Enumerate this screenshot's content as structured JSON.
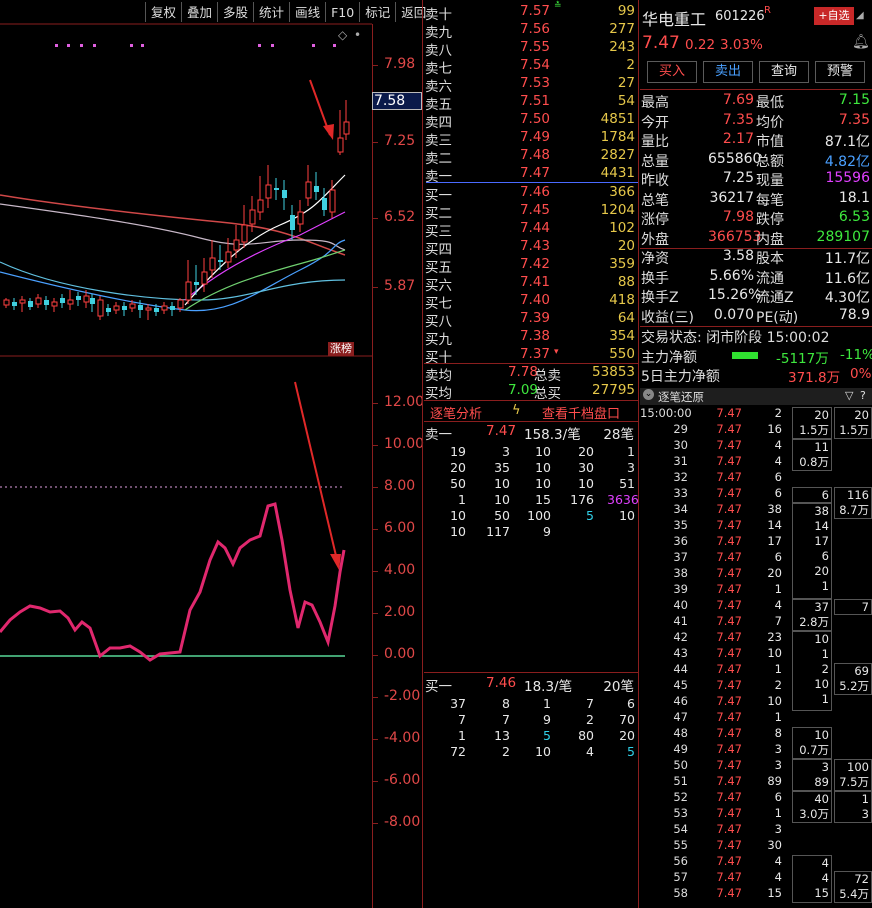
{
  "toolbar": [
    "复权",
    "叠加",
    "多股",
    "统计",
    "画线",
    "F10",
    "标记",
    "返回"
  ],
  "price_axis": [
    "7.98",
    "7.25",
    "6.52",
    "5.87"
  ],
  "current_price_tag": "7.58",
  "zhangbang": "涨榜",
  "indicator_axis": [
    "12.00",
    "10.00",
    "8.00",
    "6.00",
    "4.00",
    "2.00",
    "0.00",
    "-2.00",
    "-4.00",
    "-6.00",
    "-8.00"
  ],
  "asks": [
    {
      "label": "卖十",
      "price": "7.57",
      "vol": "99"
    },
    {
      "label": "卖九",
      "price": "7.56",
      "vol": "277"
    },
    {
      "label": "卖八",
      "price": "7.55",
      "vol": "243"
    },
    {
      "label": "卖七",
      "price": "7.54",
      "vol": "2"
    },
    {
      "label": "卖六",
      "price": "7.53",
      "vol": "27"
    },
    {
      "label": "卖五",
      "price": "7.51",
      "vol": "54"
    },
    {
      "label": "卖四",
      "price": "7.50",
      "vol": "4851"
    },
    {
      "label": "卖三",
      "price": "7.49",
      "vol": "1784"
    },
    {
      "label": "卖二",
      "price": "7.48",
      "vol": "2827"
    },
    {
      "label": "卖一",
      "price": "7.47",
      "vol": "4431"
    }
  ],
  "bids": [
    {
      "label": "买一",
      "price": "7.46",
      "vol": "366"
    },
    {
      "label": "买二",
      "price": "7.45",
      "vol": "1204"
    },
    {
      "label": "买三",
      "price": "7.44",
      "vol": "102"
    },
    {
      "label": "买四",
      "price": "7.43",
      "vol": "20"
    },
    {
      "label": "买五",
      "price": "7.42",
      "vol": "359"
    },
    {
      "label": "买六",
      "price": "7.41",
      "vol": "88"
    },
    {
      "label": "买七",
      "price": "7.40",
      "vol": "418"
    },
    {
      "label": "买八",
      "price": "7.39",
      "vol": "64"
    },
    {
      "label": "买九",
      "price": "7.38",
      "vol": "354"
    },
    {
      "label": "买十",
      "price": "7.37",
      "vol": "550"
    }
  ],
  "avg": {
    "sell_label": "卖均",
    "sell_price": "7.78",
    "sell_total_label": "总卖",
    "sell_total": "53853",
    "buy_label": "买均",
    "buy_price": "7.09",
    "buy_total_label": "总买",
    "buy_total": "27795"
  },
  "tabs": {
    "left": "逐笔分析",
    "right": "查看千档盘口"
  },
  "queue_sell": {
    "label": "卖一",
    "price": "7.47",
    "amount": "158.3/笔",
    "count": "28笔",
    "rows": [
      [
        "19",
        "3",
        "10",
        "20",
        "1"
      ],
      [
        "20",
        "35",
        "10",
        "30",
        "3"
      ],
      [
        "50",
        "10",
        "10",
        "10",
        "51"
      ],
      [
        "1",
        "10",
        "15",
        "176",
        "3636"
      ],
      [
        "10",
        "50",
        "100",
        "5",
        "10"
      ],
      [
        "10",
        "117",
        "9",
        "",
        ""
      ]
    ]
  },
  "queue_buy": {
    "label": "买一",
    "price": "7.46",
    "amount": "18.3/笔",
    "count": "20笔",
    "rows": [
      [
        "37",
        "8",
        "1",
        "7",
        "6"
      ],
      [
        "7",
        "7",
        "9",
        "2",
        "70"
      ],
      [
        "1",
        "13",
        "5",
        "80",
        "20"
      ],
      [
        "72",
        "2",
        "10",
        "4",
        "5"
      ]
    ]
  },
  "stock": {
    "name": "华电重工",
    "code": "601226",
    "flag": "R",
    "add_label": "+自选",
    "price": "7.47",
    "change": "0.22",
    "pct": "3.03%"
  },
  "actions": [
    "买入",
    "卖出",
    "查询",
    "预警"
  ],
  "stats": [
    [
      "最高",
      "7.69",
      "最低",
      "7.15"
    ],
    [
      "今开",
      "7.35",
      "均价",
      "7.35"
    ],
    [
      "量比",
      "2.17",
      "市值",
      "87.1亿"
    ],
    [
      "总量",
      "655860",
      "总额",
      "4.82亿"
    ],
    [
      "昨收",
      "7.25",
      "现量",
      "15596"
    ],
    [
      "总笔",
      "36217",
      "每笔",
      "18.1"
    ],
    [
      "涨停",
      "7.98",
      "跌停",
      "6.53"
    ],
    [
      "外盘",
      "366753",
      "内盘",
      "289107"
    ],
    [
      "净资",
      "3.58",
      "股本",
      "11.7亿"
    ],
    [
      "换手",
      "5.66%",
      "流通",
      "11.6亿"
    ],
    [
      "换手Z",
      "15.26%",
      "流通Z",
      "4.30亿"
    ],
    [
      "收益(三)",
      "0.070",
      "PE(动)",
      "78.9"
    ]
  ],
  "trade_status": "交易状态: 闭市阶段 15:00:02",
  "main_net": {
    "label": "主力净额",
    "value": "-5117万",
    "pct": "-11%"
  },
  "main_net5": {
    "label": "5日主力净额",
    "value": "371.8万",
    "pct": "0%"
  },
  "tick_title": "逐笔还原",
  "ticks": [
    [
      "15:00:00",
      "7.47",
      "2"
    ],
    [
      "29",
      "7.47",
      "16"
    ],
    [
      "30",
      "7.47",
      "4"
    ],
    [
      "31",
      "7.47",
      "4"
    ],
    [
      "32",
      "7.47",
      "6"
    ],
    [
      "33",
      "7.47",
      "6"
    ],
    [
      "34",
      "7.47",
      "38"
    ],
    [
      "35",
      "7.47",
      "14"
    ],
    [
      "36",
      "7.47",
      "17"
    ],
    [
      "37",
      "7.47",
      "6"
    ],
    [
      "38",
      "7.47",
      "20"
    ],
    [
      "39",
      "7.47",
      "1"
    ],
    [
      "40",
      "7.47",
      "4"
    ],
    [
      "41",
      "7.47",
      "7"
    ],
    [
      "42",
      "7.47",
      "23"
    ],
    [
      "43",
      "7.47",
      "10"
    ],
    [
      "44",
      "7.47",
      "1"
    ],
    [
      "45",
      "7.47",
      "2"
    ],
    [
      "46",
      "7.47",
      "10"
    ],
    [
      "47",
      "7.47",
      "1"
    ],
    [
      "48",
      "7.47",
      "8"
    ],
    [
      "49",
      "7.47",
      "3"
    ],
    [
      "50",
      "7.47",
      "3"
    ],
    [
      "51",
      "7.47",
      "89"
    ],
    [
      "52",
      "7.47",
      "6"
    ],
    [
      "53",
      "7.47",
      "1"
    ],
    [
      "54",
      "7.47",
      "3"
    ],
    [
      "55",
      "7.47",
      "30"
    ],
    [
      "56",
      "7.47",
      "4"
    ],
    [
      "57",
      "7.47",
      "4"
    ],
    [
      "58",
      "7.47",
      "15"
    ]
  ],
  "tick_boxes_a": [
    {
      "rows": [
        "20",
        "1.5万"
      ]
    },
    {
      "rows": [
        "11",
        "0.8万"
      ]
    },
    {
      "rows": [
        "6"
      ]
    },
    {
      "rows": [
        "38",
        "14",
        "17",
        "6",
        "20",
        "1"
      ]
    },
    {
      "rows": [
        "37",
        "2.8万"
      ]
    },
    {
      "rows": [
        "10",
        "1",
        "2",
        "10",
        "1"
      ]
    },
    {
      "rows": [
        "10",
        "0.7万"
      ]
    },
    {
      "rows": [
        "3",
        "89"
      ]
    },
    {
      "rows": [
        "40",
        "3.0万"
      ]
    },
    {
      "rows": [
        "4",
        "4",
        "15"
      ]
    }
  ],
  "tick_boxes_b": [
    {
      "rows": [
        "20",
        "1.5万"
      ]
    },
    {
      "rows": [
        "116",
        "8.7万"
      ]
    },
    {
      "rows": [
        "7"
      ]
    },
    {
      "rows": [
        "69",
        "5.2万"
      ]
    },
    {
      "rows": [
        "100",
        "7.5万"
      ]
    },
    {
      "rows": [
        "1",
        "3"
      ]
    },
    {
      "rows": [
        "72",
        "5.4万"
      ]
    }
  ]
}
